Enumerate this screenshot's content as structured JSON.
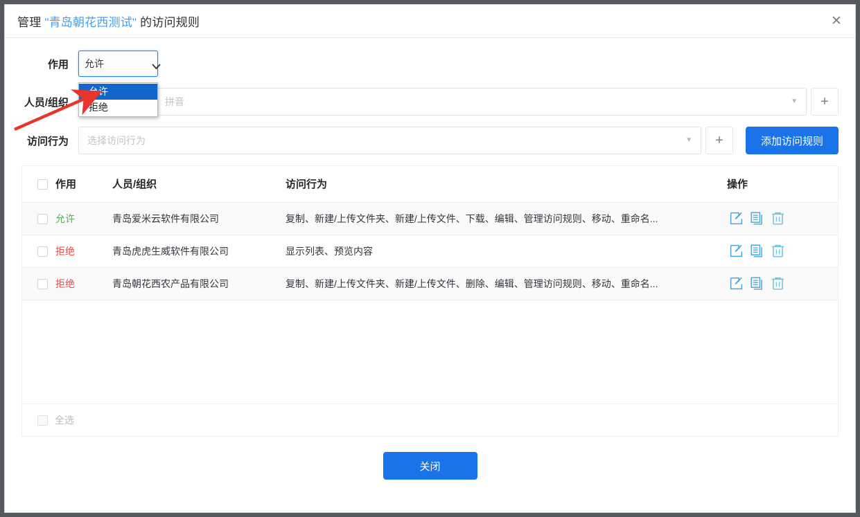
{
  "dialog": {
    "title_prefix": "管理 ",
    "title_highlight": "\"青岛朝花西测试\"",
    "title_suffix": " 的访问规则",
    "close_icon": "✕"
  },
  "form": {
    "effect": {
      "label": "作用",
      "selected": "允许",
      "caret_icon": "chevron-down-icon",
      "options": [
        {
          "label": "允许",
          "selected": true
        },
        {
          "label": "拒绝",
          "selected": false
        }
      ]
    },
    "person": {
      "label": "人员/组织",
      "placeholder": "选择人员、部门、拼音",
      "arrow_icon": "▼",
      "add_icon": "+"
    },
    "behavior": {
      "label": "访问行为",
      "placeholder": "选择访问行为",
      "arrow_icon": "▼",
      "add_icon": "+"
    },
    "add_rule_button": "添加访问规则"
  },
  "table": {
    "headers": {
      "checkbox": "",
      "effect": "作用",
      "person": "人员/组织",
      "behavior": "访问行为",
      "ops": "操作"
    },
    "rows": [
      {
        "effect": "允许",
        "effect_type": "allow",
        "person": "青岛爱米云软件有限公司",
        "behavior": "复制、新建/上传文件夹、新建/上传文件、下载、编辑、管理访问规则、移动、重命名...",
        "ops": [
          "edit-icon",
          "copy-icon",
          "delete-icon"
        ]
      },
      {
        "effect": "拒绝",
        "effect_type": "deny",
        "person": "青岛虎虎生威软件有限公司",
        "behavior": "显示列表、预览内容",
        "ops": [
          "edit-icon",
          "copy-icon",
          "delete-icon"
        ]
      },
      {
        "effect": "拒绝",
        "effect_type": "deny",
        "person": "青岛朝花西农产品有限公司",
        "behavior": "复制、新建/上传文件夹、新建/上传文件、删除、编辑、管理访问规则、移动、重命名...",
        "ops": [
          "edit-icon",
          "copy-icon",
          "delete-icon"
        ]
      }
    ],
    "select_all_label": "全选"
  },
  "footer": {
    "close_button": "关闭"
  },
  "colors": {
    "primary": "#1a73e8",
    "title_highlight": "#409eff",
    "allow": "#52b352",
    "deny": "#e14c4c",
    "dropdown_selected_bg": "#1266c9",
    "icon_blue": "#4aa8d8",
    "annotation_arrow": "#e8342a"
  }
}
